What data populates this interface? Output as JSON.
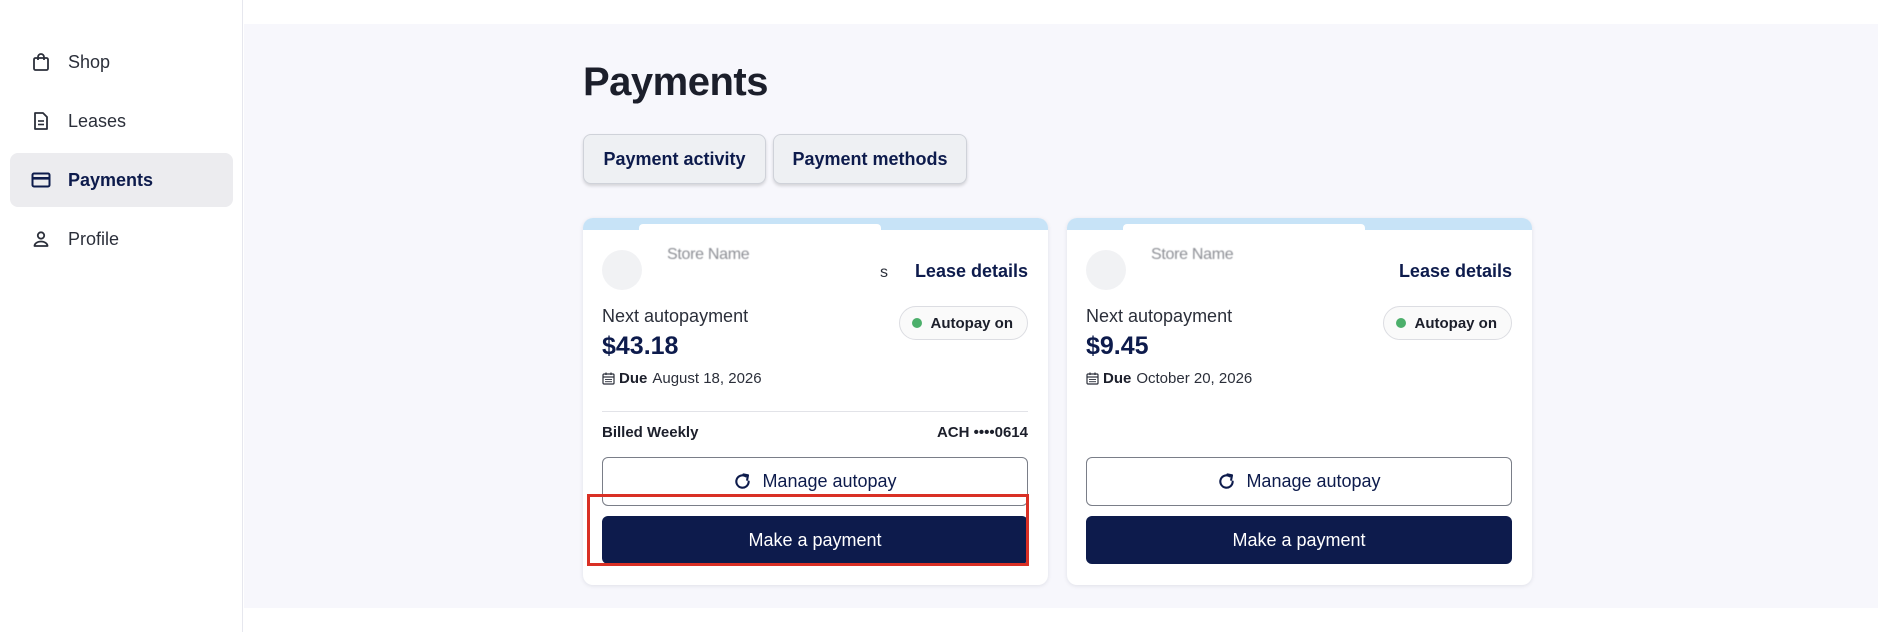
{
  "sidebar": {
    "items": [
      {
        "label": "Shop",
        "icon": "shopping-bag-icon",
        "active": false
      },
      {
        "label": "Leases",
        "icon": "document-icon",
        "active": false
      },
      {
        "label": "Payments",
        "icon": "credit-card-icon",
        "active": true
      },
      {
        "label": "Profile",
        "icon": "person-icon",
        "active": false
      }
    ]
  },
  "page": {
    "title": "Payments",
    "tabs": [
      {
        "label": "Payment activity"
      },
      {
        "label": "Payment methods"
      }
    ]
  },
  "cards": [
    {
      "store_name": "Store Name",
      "store_suffix": "s",
      "lease_link": "Lease details",
      "next_label": "Next autopayment",
      "amount": "$43.18",
      "due_label": "Due",
      "due_date": "August 18, 2026",
      "autopay_status": "Autopay on",
      "billing": "Billed Weekly",
      "payment_method": "ACH ••••0614",
      "manage_label": "Manage autopay",
      "pay_label": "Make a payment"
    },
    {
      "store_name": "Store Name",
      "lease_link": "Lease details",
      "next_label": "Next autopayment",
      "amount": "$9.45",
      "due_label": "Due",
      "due_date": "October 20, 2026",
      "autopay_status": "Autopay on",
      "manage_label": "Manage autopay",
      "pay_label": "Make a payment"
    }
  ],
  "colors": {
    "brand_navy": "#0d1b4c",
    "autopay_green": "#4caf6b",
    "card_band": "#c7e3f7",
    "highlight": "#d93025"
  }
}
